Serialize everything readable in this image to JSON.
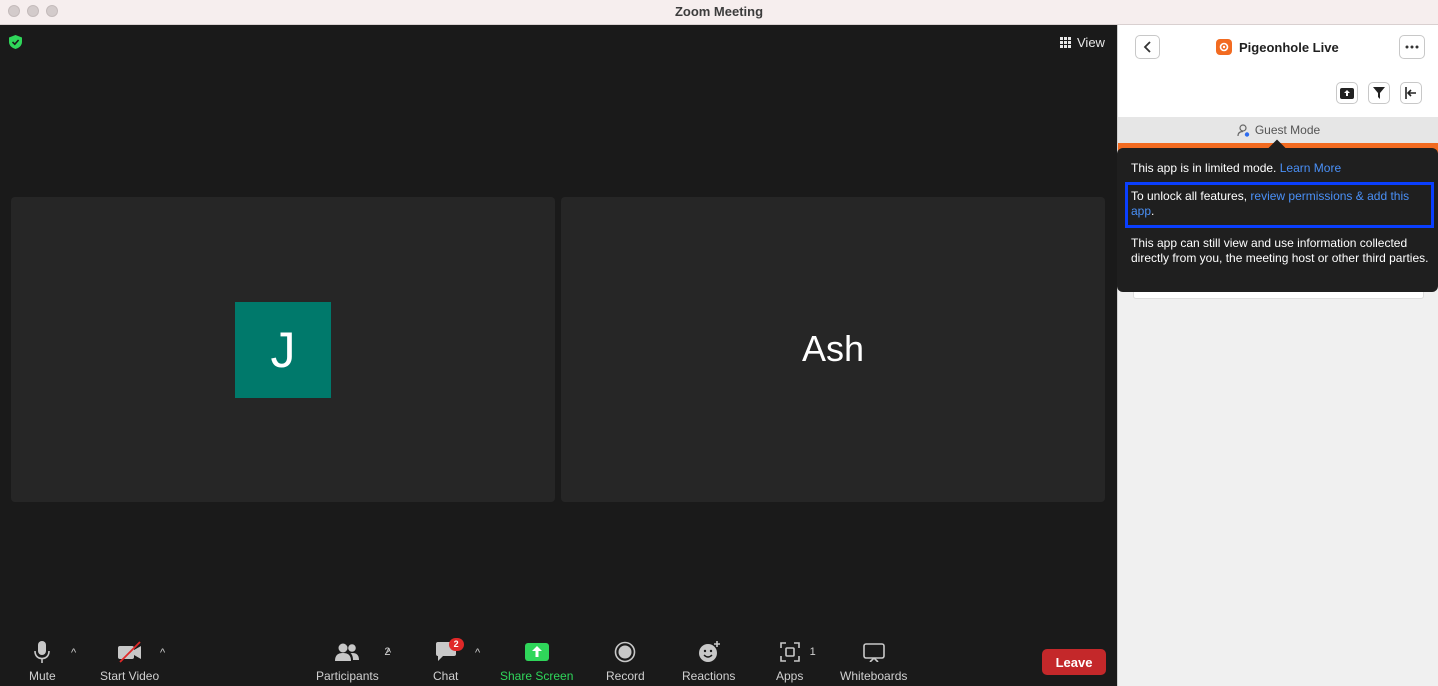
{
  "window": {
    "title": "Zoom Meeting"
  },
  "meeting": {
    "view_label": "View",
    "participants": [
      {
        "initial": "J",
        "avatar_color": "#00796b"
      },
      {
        "name": "Ash"
      }
    ]
  },
  "toolbar": {
    "mute": "Mute",
    "start_video": "Start Video",
    "participants": "Participants",
    "participants_count": "2",
    "chat": "Chat",
    "chat_badge": "2",
    "share_screen": "Share Screen",
    "record": "Record",
    "reactions": "Reactions",
    "apps": "Apps",
    "apps_count": "1",
    "whiteboards": "Whiteboards",
    "leave": "Leave"
  },
  "panel": {
    "app_name": "Pigeonhole Live",
    "guest_mode": "Guest Mode",
    "popover": {
      "line1": "This app is in limited mode.",
      "learn_more": "Learn More",
      "unlock_prefix": "To unlock all features,",
      "unlock_link": "review permissions & add this app",
      "unlock_suffix": ".",
      "line3": "This app can still view and use information collected directly from you, the meeting host or other third parties."
    }
  },
  "colors": {
    "accent_green": "#2fd65a",
    "leave_red": "#c4282a",
    "brand_orange": "#f26b21",
    "highlight_blue": "#0a3fff",
    "link_blue": "#4a90f7"
  }
}
